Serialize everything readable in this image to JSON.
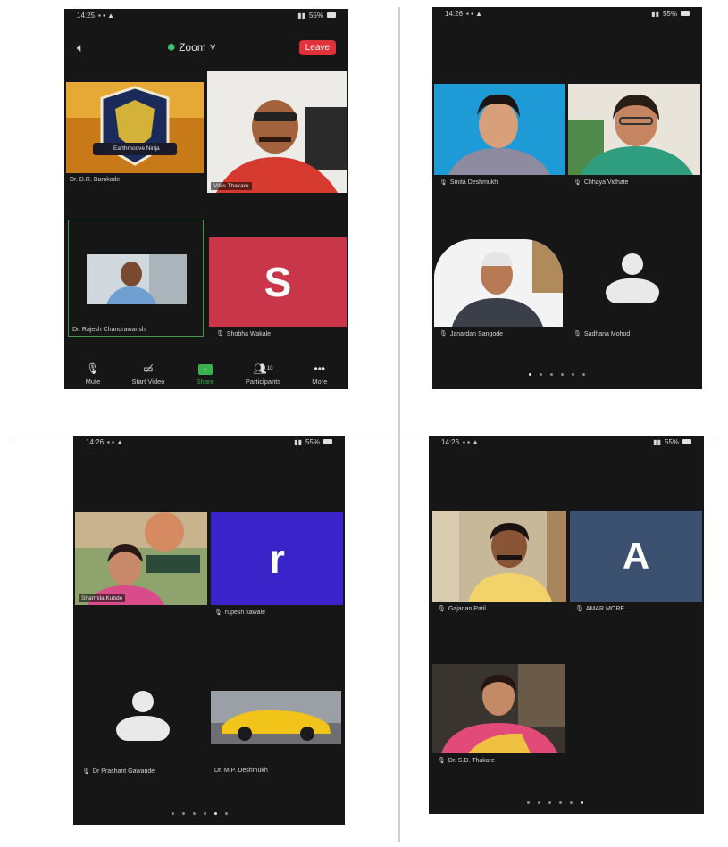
{
  "screens": [
    {
      "status": {
        "time": "14:25",
        "battery": "55%"
      },
      "header": {
        "title": "Zoom",
        "leave_label": "Leave"
      },
      "tiles": [
        {
          "name": "Dr. D.R. Bamkode",
          "logo_text": "Earthmoove Ninja"
        },
        {
          "name": "Vilas Thakare"
        },
        {
          "name": "Dr. Rajesh Chandrawanshi"
        },
        {
          "name": "Shobha Wakale",
          "initial": "S",
          "color": "#c9364a"
        }
      ],
      "toolbar": [
        {
          "label": "Mute",
          "icon": "microphone-icon"
        },
        {
          "label": "Start Video",
          "icon": "video-off-icon"
        },
        {
          "label": "Share",
          "icon": "share-screen-icon"
        },
        {
          "label": "Participants",
          "icon": "participants-icon",
          "count": "10"
        },
        {
          "label": "More",
          "icon": "more-icon"
        }
      ]
    },
    {
      "status": {
        "time": "14:26",
        "battery": "55%"
      },
      "tiles": [
        {
          "name": "Smita Deshmukh"
        },
        {
          "name": "Chhaya Vidhate"
        },
        {
          "name": "Janardan Sangode"
        },
        {
          "name": "Sadhana Mohod"
        }
      ],
      "pages": {
        "count": 6,
        "active": 0
      }
    },
    {
      "status": {
        "time": "14:26",
        "battery": "55%"
      },
      "tiles": [
        {
          "name": "Sharmila Kubde"
        },
        {
          "name": "rupesh kawale",
          "initial": "r",
          "color": "#3a24c9"
        },
        {
          "name": "Dr Prashant Gawande"
        },
        {
          "name": "Dr. M.P. Deshmukh"
        }
      ],
      "pages": {
        "count": 6,
        "active": 4
      }
    },
    {
      "status": {
        "time": "14:26",
        "battery": "55%"
      },
      "tiles": [
        {
          "name": "Gajanan Patil"
        },
        {
          "name": "AMAR MORE",
          "initial": "A",
          "color": "#3c5170"
        },
        {
          "name": "Dr. S.D. Thakare"
        }
      ],
      "pages": {
        "count": 6,
        "active": 5
      }
    }
  ]
}
